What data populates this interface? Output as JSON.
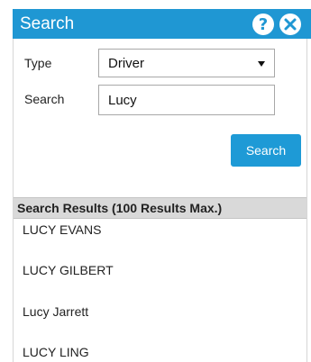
{
  "header": {
    "title": "Search",
    "help_icon": "help-icon",
    "close_icon": "close-icon",
    "accent_color": "#1f97d3"
  },
  "form": {
    "type_label": "Type",
    "type_value": "Driver",
    "search_label": "Search",
    "search_value": "Lucy",
    "search_button_label": "Search"
  },
  "results": {
    "header_label": "Search Results (100 Results Max.)",
    "items": [
      {
        "label": "LUCY EVANS"
      },
      {
        "label": "LUCY GILBERT"
      },
      {
        "label": "Lucy Jarrett"
      },
      {
        "label": "LUCY LING"
      }
    ]
  }
}
